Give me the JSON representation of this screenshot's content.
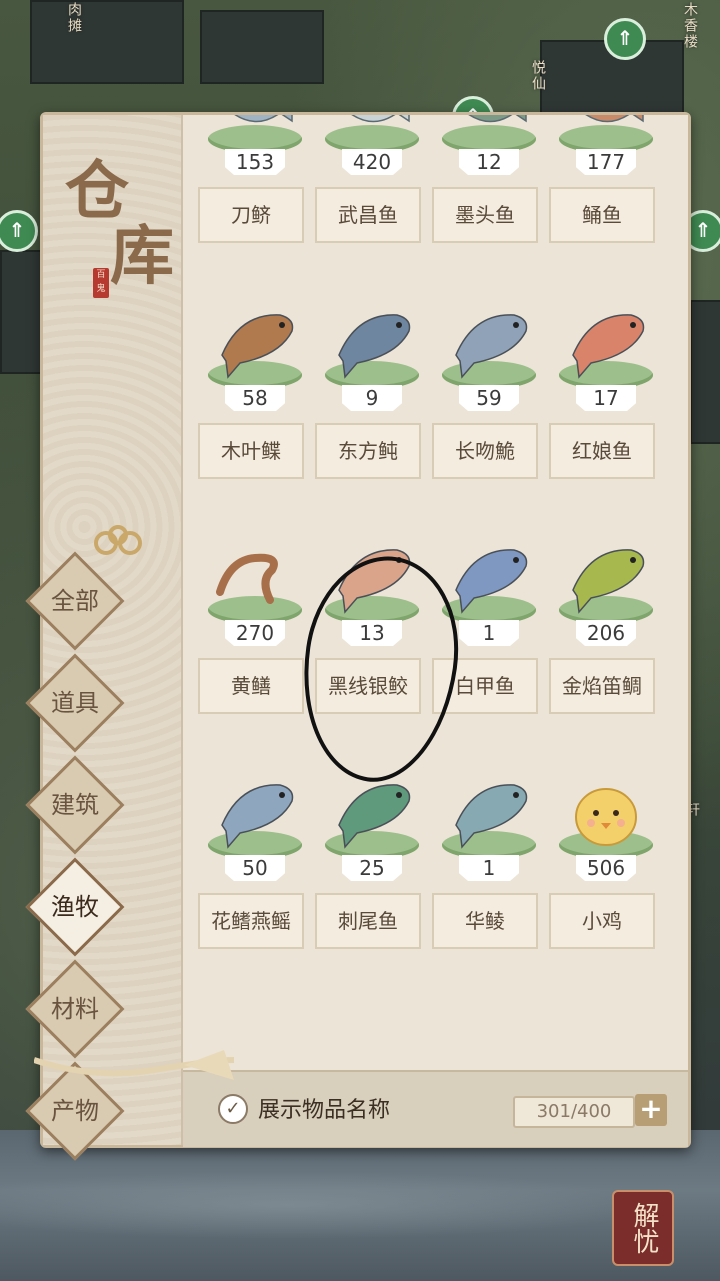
{
  "panel_title": [
    "仓",
    "库"
  ],
  "seal_text": "百鬼",
  "map_labels": [
    "肉摊",
    "悦仙",
    "木香楼",
    "轩"
  ],
  "tabs": [
    {
      "label": "全部",
      "active": false
    },
    {
      "label": "道具",
      "active": false
    },
    {
      "label": "建筑",
      "active": false
    },
    {
      "label": "渔牧",
      "active": true
    },
    {
      "label": "材料",
      "active": false
    },
    {
      "label": "产物",
      "active": false
    }
  ],
  "items": [
    {
      "name": "刀鲚",
      "count": "153",
      "icon": "fish-tail-icon",
      "color": "#9fb3c2"
    },
    {
      "name": "武昌鱼",
      "count": "420",
      "icon": "fish-tail-icon",
      "color": "#c9d3d6"
    },
    {
      "name": "墨头鱼",
      "count": "12",
      "icon": "fish-tail-icon",
      "color": "#7d9a86"
    },
    {
      "name": "鲬鱼",
      "count": "177",
      "icon": "fish-tail-icon",
      "color": "#c98a6a"
    },
    {
      "name": "木叶鲽",
      "count": "58",
      "icon": "flatfish-icon",
      "color": "#b07a4e"
    },
    {
      "name": "东方鲀",
      "count": "9",
      "icon": "pufferfish-icon",
      "color": "#6f86a0"
    },
    {
      "name": "长吻鮠",
      "count": "59",
      "icon": "catfish-icon",
      "color": "#8fa2b8"
    },
    {
      "name": "红娘鱼",
      "count": "17",
      "icon": "gurnard-icon",
      "color": "#d9846a"
    },
    {
      "name": "黄鳝",
      "count": "270",
      "icon": "eel-icon",
      "color": "#a8704a"
    },
    {
      "name": "黑线银鲛",
      "count": "13",
      "icon": "chimaera-icon",
      "color": "#d9a48a"
    },
    {
      "name": "白甲鱼",
      "count": "1",
      "icon": "fish-icon",
      "color": "#7f98c2"
    },
    {
      "name": "金焰笛鲷",
      "count": "206",
      "icon": "snapper-icon",
      "color": "#a6b84e"
    },
    {
      "name": "花鳍燕鳐",
      "count": "50",
      "icon": "flying-fish-icon",
      "color": "#8ea7bf"
    },
    {
      "name": "刺尾鱼",
      "count": "25",
      "icon": "surgeonfish-icon",
      "color": "#5f9a7c"
    },
    {
      "name": "华鲮",
      "count": "1",
      "icon": "fish-icon",
      "color": "#86a9b2"
    },
    {
      "name": "小鸡",
      "count": "506",
      "icon": "chick-icon",
      "color": "#f4d06a"
    }
  ],
  "footer": {
    "show_names_label": "展示物品名称",
    "show_names_checked": true,
    "capacity": "301/400",
    "plus_label": "+"
  },
  "logo_text": "解忧"
}
